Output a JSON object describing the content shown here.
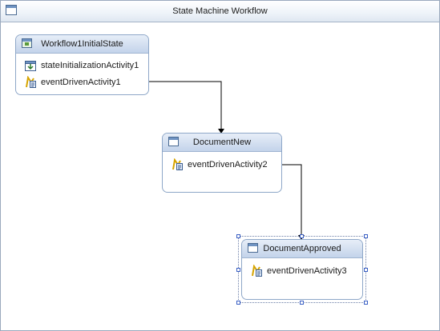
{
  "designer": {
    "title": "State Machine Workflow"
  },
  "states": [
    {
      "name": "Workflow1InitialState",
      "activities": [
        "stateInitializationActivity1",
        "eventDrivenActivity1"
      ]
    },
    {
      "name": "DocumentNew",
      "activities": [
        "eventDrivenActivity2"
      ]
    },
    {
      "name": "DocumentApproved",
      "activities": [
        "eventDrivenActivity3"
      ]
    }
  ],
  "colors": {
    "state_border": "#8ea7c8",
    "header_top": "#e7eef8",
    "header_bottom": "#c3d3ea",
    "connector": "#000000",
    "selection_handle": "#3a5fc4"
  }
}
